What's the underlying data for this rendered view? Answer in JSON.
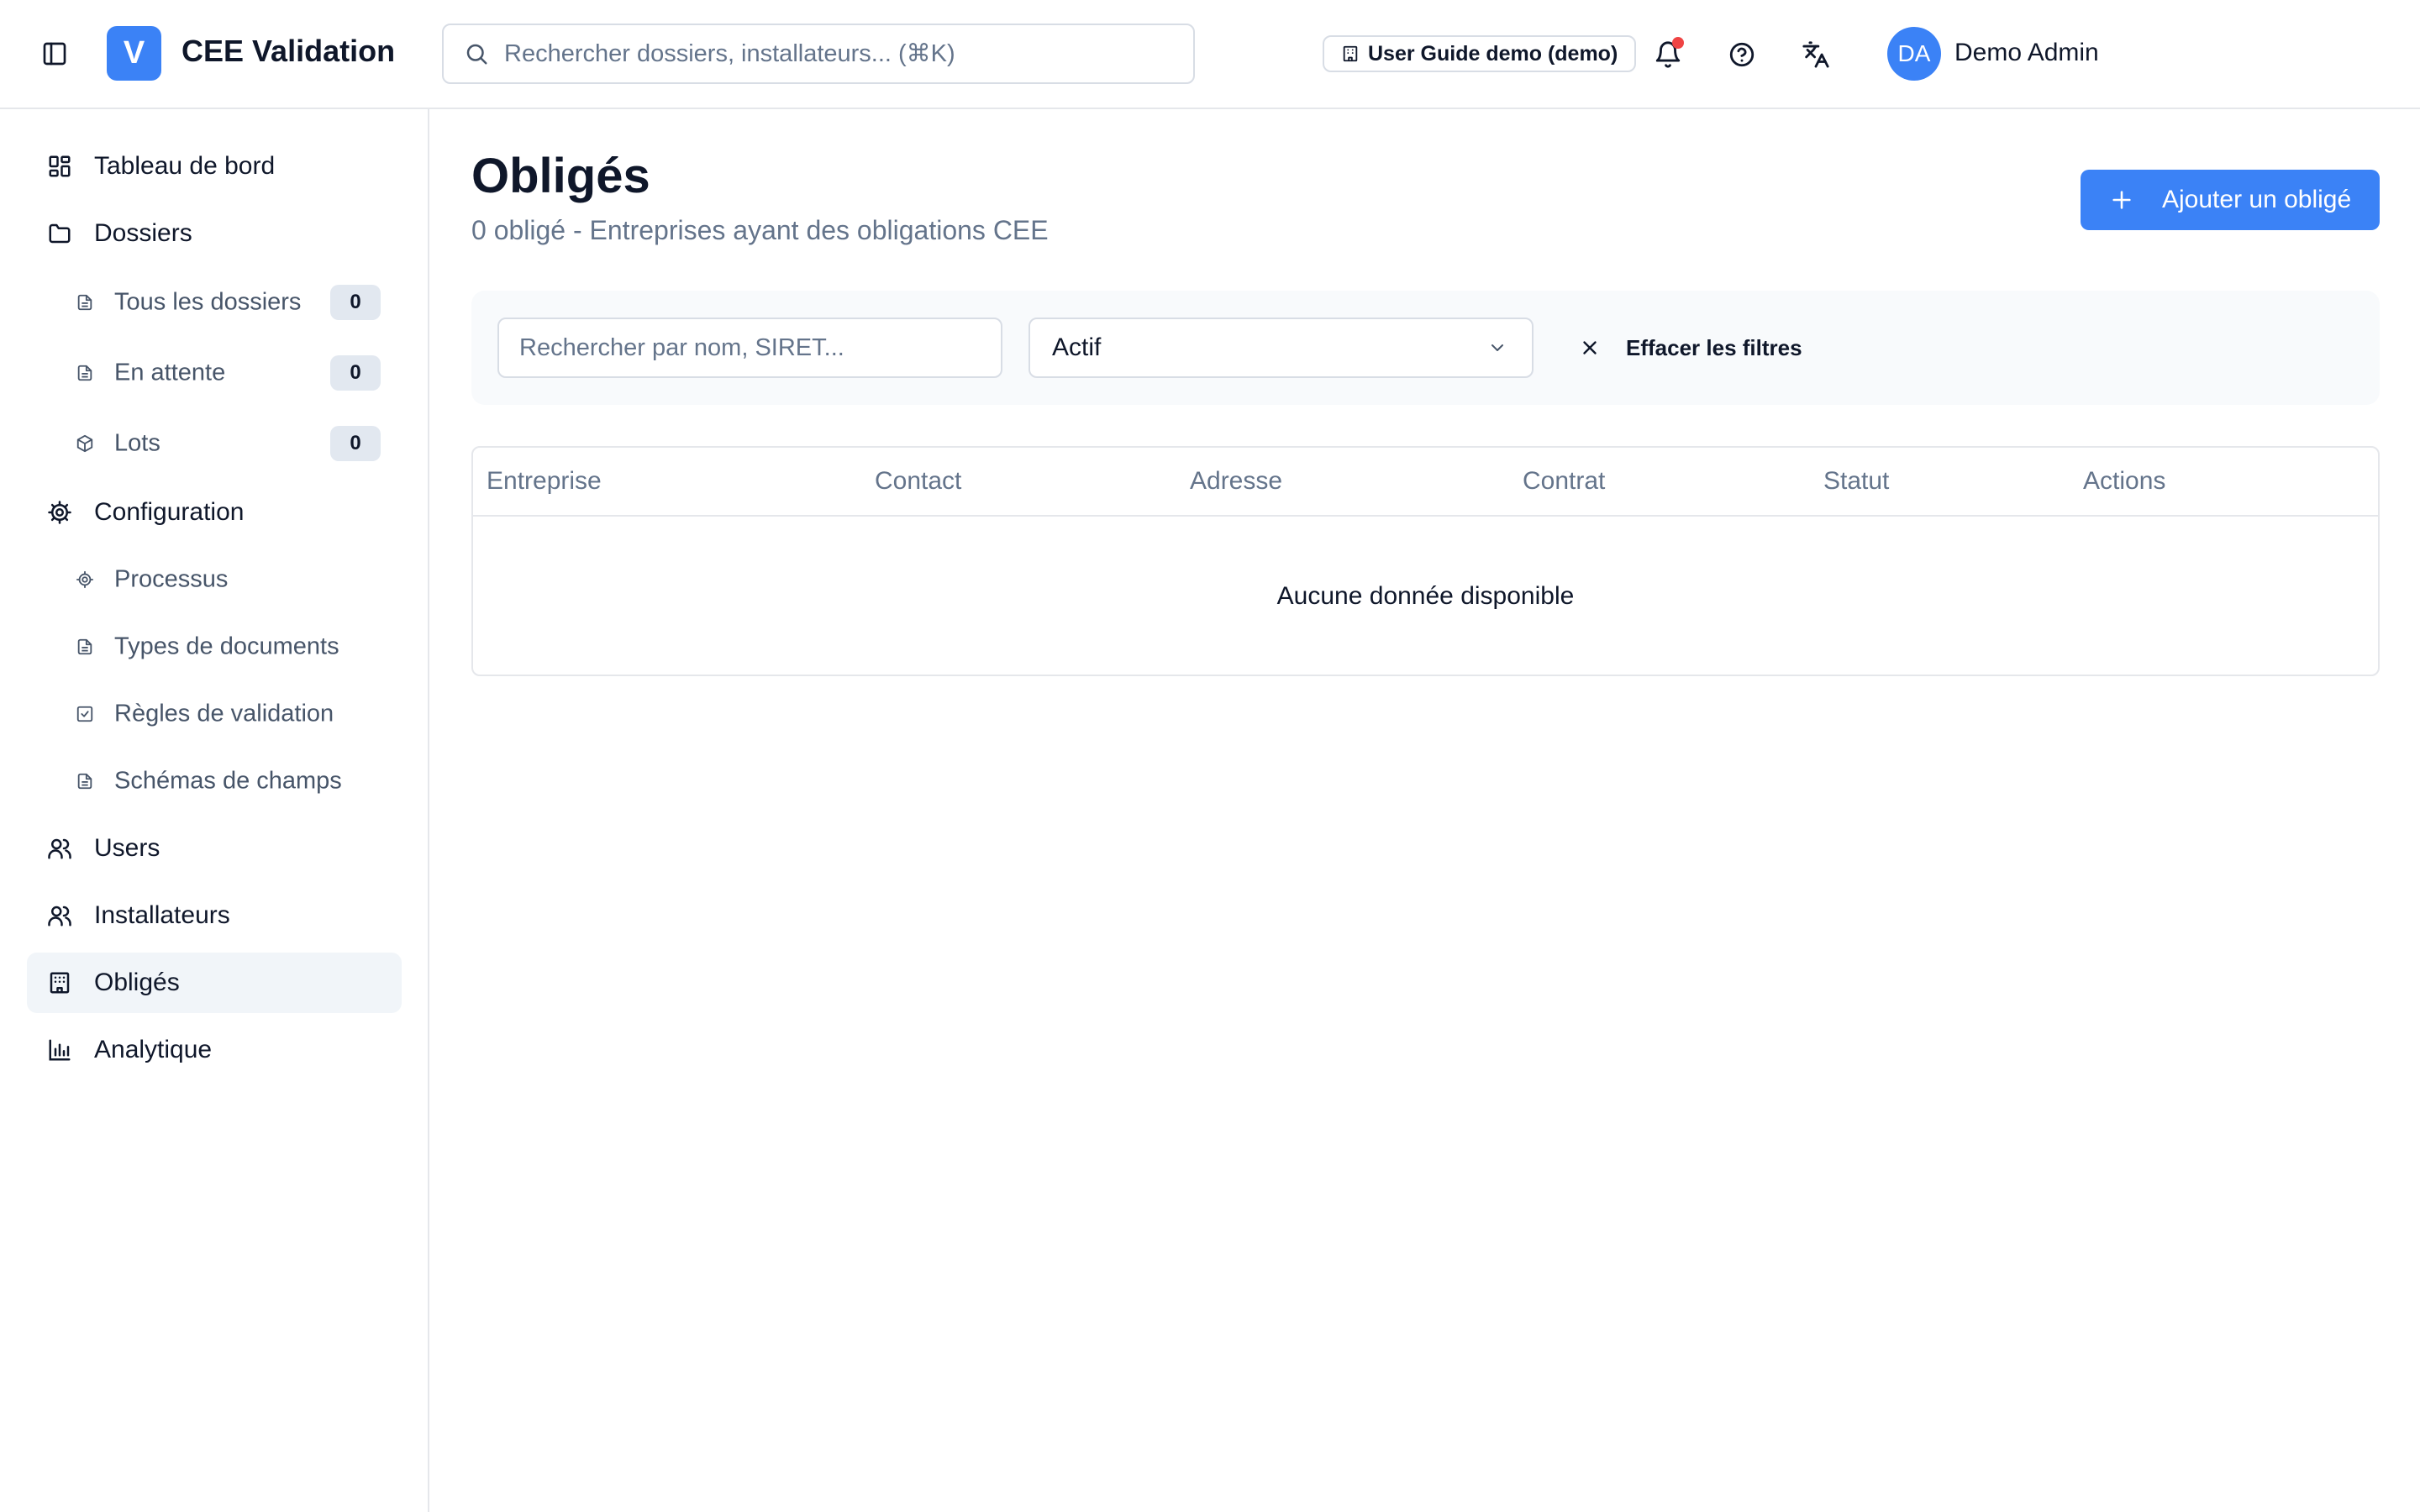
{
  "header": {
    "logo_letter": "V",
    "app_title": "CEE Validation",
    "search_placeholder": "Rechercher dossiers, installateurs... (⌘K)",
    "tenant_badge": "User Guide demo (demo)",
    "user_initials": "DA",
    "user_name": "Demo Admin"
  },
  "sidebar": {
    "items": [
      {
        "label": "Tableau de bord",
        "icon": "dashboard-icon"
      },
      {
        "label": "Dossiers",
        "icon": "folder-icon"
      },
      {
        "label": "Tous les dossiers",
        "icon": "document-icon",
        "count": "0"
      },
      {
        "label": "En attente",
        "icon": "document-icon",
        "count": "0"
      },
      {
        "label": "Lots",
        "icon": "package-icon",
        "count": "0"
      },
      {
        "label": "Configuration",
        "icon": "gear-icon"
      },
      {
        "label": "Processus",
        "icon": "gear-icon"
      },
      {
        "label": "Types de documents",
        "icon": "document-icon"
      },
      {
        "label": "Règles de validation",
        "icon": "checkbox-icon"
      },
      {
        "label": "Schémas de champs",
        "icon": "document-icon"
      },
      {
        "label": "Users",
        "icon": "users-icon"
      },
      {
        "label": "Installateurs",
        "icon": "users-icon"
      },
      {
        "label": "Obligés",
        "icon": "building-icon",
        "active": true
      },
      {
        "label": "Analytique",
        "icon": "bar-chart-icon"
      }
    ]
  },
  "main": {
    "title": "Obligés",
    "subtitle": "0 obligé - Entreprises ayant des obligations CEE",
    "add_button": "Ajouter un obligé",
    "filters": {
      "search_placeholder": "Rechercher par nom, SIRET...",
      "status_value": "Actif",
      "clear_label": "Effacer les filtres"
    },
    "table": {
      "columns": [
        "Entreprise",
        "Contact",
        "Adresse",
        "Contrat",
        "Statut",
        "Actions"
      ],
      "empty_message": "Aucune donnée disponible"
    }
  },
  "colors": {
    "accent": "#3b82f6",
    "notification_dot": "#ef4444",
    "active_nav_bg": "#f1f5f9",
    "muted_text": "#64748b"
  }
}
